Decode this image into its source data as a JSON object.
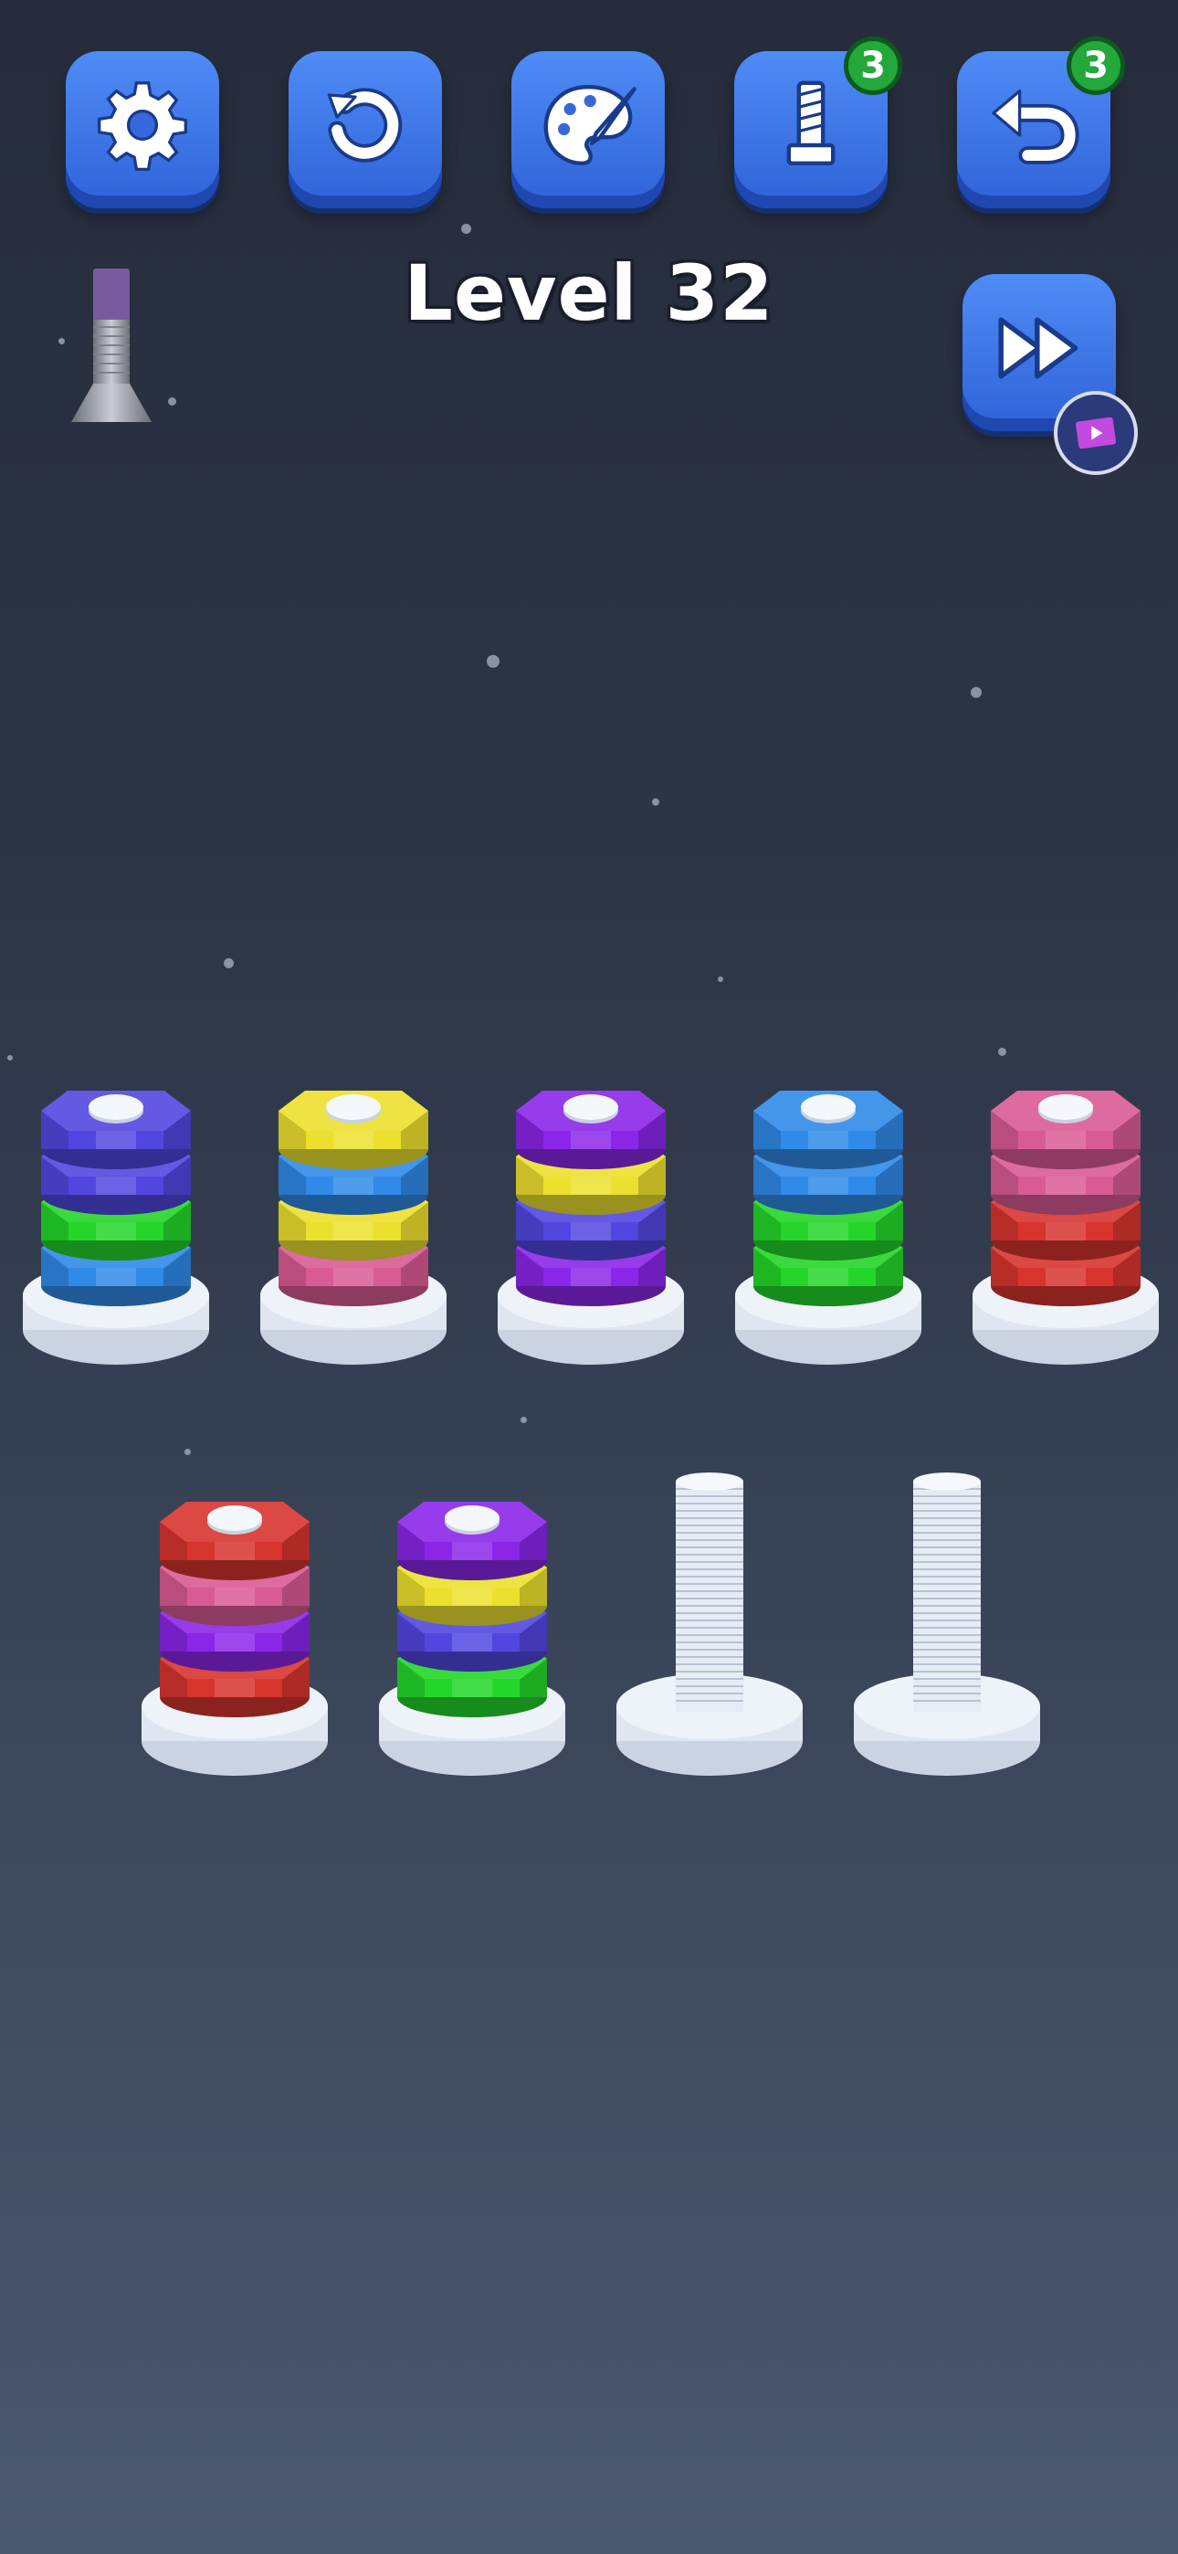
{
  "header": {
    "level_title": "Level 32",
    "buttons": [
      {
        "name": "settings-button",
        "icon": "gear-icon"
      },
      {
        "name": "restart-button",
        "icon": "restart-icon"
      },
      {
        "name": "theme-button",
        "icon": "palette-icon"
      },
      {
        "name": "extra-screw-button",
        "icon": "screw-icon",
        "badge": "3"
      },
      {
        "name": "undo-button",
        "icon": "undo-icon",
        "badge": "3"
      }
    ],
    "skip_button": {
      "icon": "fast-forward-icon",
      "ad_icon": "video-ad-icon"
    }
  },
  "colors": {
    "blue": "#2f8ae8",
    "indigo": "#5246e0",
    "green": "#24d62a",
    "yellow": "#ece02e",
    "pink": "#d95b94",
    "purple": "#8a26e8",
    "red": "#d8342e",
    "accent_button": "#3c74e6",
    "badge_green": "#23a83c"
  },
  "rows": [
    [
      {
        "nuts": [
          "blue",
          "green",
          "indigo",
          "indigo"
        ]
      },
      {
        "nuts": [
          "pink",
          "yellow",
          "blue",
          "yellow"
        ]
      },
      {
        "nuts": [
          "purple",
          "indigo",
          "yellow",
          "purple"
        ]
      },
      {
        "nuts": [
          "green",
          "green",
          "blue",
          "blue"
        ]
      },
      {
        "nuts": [
          "red",
          "red",
          "pink",
          "pink"
        ]
      }
    ],
    [
      {
        "nuts": [
          "red",
          "purple",
          "pink",
          "red"
        ]
      },
      {
        "nuts": [
          "green",
          "indigo",
          "yellow",
          "purple"
        ]
      },
      {
        "nuts": []
      },
      {
        "nuts": []
      }
    ]
  ]
}
